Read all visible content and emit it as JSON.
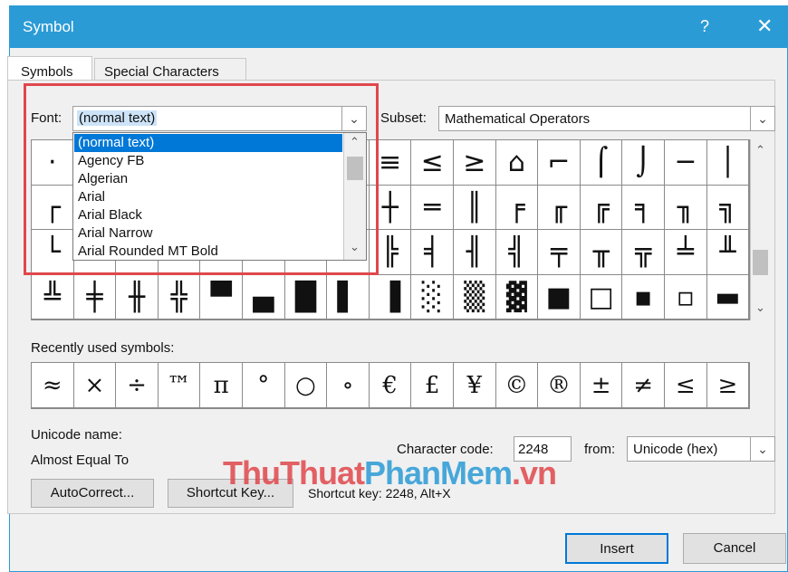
{
  "window": {
    "title": "Symbol",
    "help": "?",
    "close": "✕"
  },
  "tabs": [
    {
      "label": "Symbols"
    },
    {
      "label": "Special Characters"
    }
  ],
  "font": {
    "label": "Font:",
    "value": "(normal text)",
    "options": [
      "(normal text)",
      "Agency FB",
      "Algerian",
      "Arial",
      "Arial Black",
      "Arial Narrow",
      "Arial Rounded MT Bold"
    ]
  },
  "subset": {
    "label": "Subset:",
    "value": "Mathematical Operators"
  },
  "symbol_rows": [
    [
      "·",
      "",
      "",
      "",
      "",
      "",
      "",
      "",
      "≡",
      "≤",
      "≥",
      "⌂",
      "⌐",
      "⌠",
      "⌡",
      "─",
      "│"
    ],
    [
      "┌",
      "",
      "",
      "",
      "",
      "",
      "",
      "",
      "┼",
      "═",
      "║",
      "╒",
      "╓",
      "╔",
      "╕",
      "╖",
      "╗"
    ],
    [
      "└",
      "",
      "",
      "",
      "",
      "",
      "",
      "",
      "╠",
      "╡",
      "╢",
      "╣",
      "╤",
      "╥",
      "╦",
      "╧",
      "╨"
    ],
    [
      "╩",
      "╪",
      "╫",
      "╬",
      "▀",
      "▄",
      "█",
      "▌",
      "▐",
      "░",
      "▒",
      "▓",
      "■",
      "□",
      "▪",
      "▫",
      "▬"
    ]
  ],
  "recent": {
    "label": "Recently used symbols:",
    "symbols": [
      "≈",
      "×",
      "÷",
      "™",
      "π",
      "°",
      "○",
      "∘",
      "€",
      "£",
      "¥",
      "©",
      "®",
      "±",
      "≠",
      "≤",
      "≥"
    ]
  },
  "unicode_name": {
    "label": "Unicode name:",
    "value": "Almost Equal To"
  },
  "char_code": {
    "label": "Character code:",
    "value": "2248"
  },
  "from": {
    "label": "from:",
    "value": "Unicode (hex)"
  },
  "buttons": {
    "autocorrect": "AutoCorrect...",
    "shortcut_key": "Shortcut Key...",
    "insert": "Insert",
    "cancel": "Cancel"
  },
  "shortcut_text": "Shortcut key: 2248, Alt+X",
  "watermark": {
    "part1": "ThuThuat",
    "part2": "PhanMem",
    "part3": ".vn"
  },
  "colors": {
    "titlebar": "#2b9bd6",
    "highlight": "#0078d7",
    "annotation": "#e0474c"
  }
}
